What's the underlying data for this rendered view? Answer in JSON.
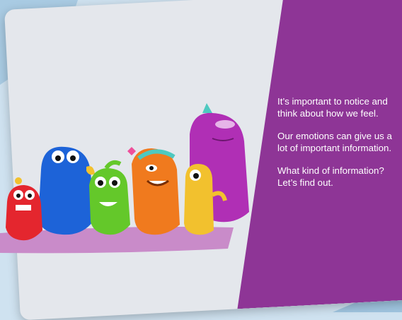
{
  "slide": {
    "paragraphs": [
      "It’s important to notice and think about how we feel.",
      "Our emotions can give us a lot of important information.",
      "What kind of information? Let’s find out."
    ]
  },
  "colors": {
    "panel": "#8e3596",
    "background": "#e4e7ec",
    "floor": "#c98bc9"
  },
  "characters": [
    "red-monster",
    "blue-monster",
    "green-monster",
    "orange-monster",
    "yellow-monster",
    "purple-monster"
  ]
}
